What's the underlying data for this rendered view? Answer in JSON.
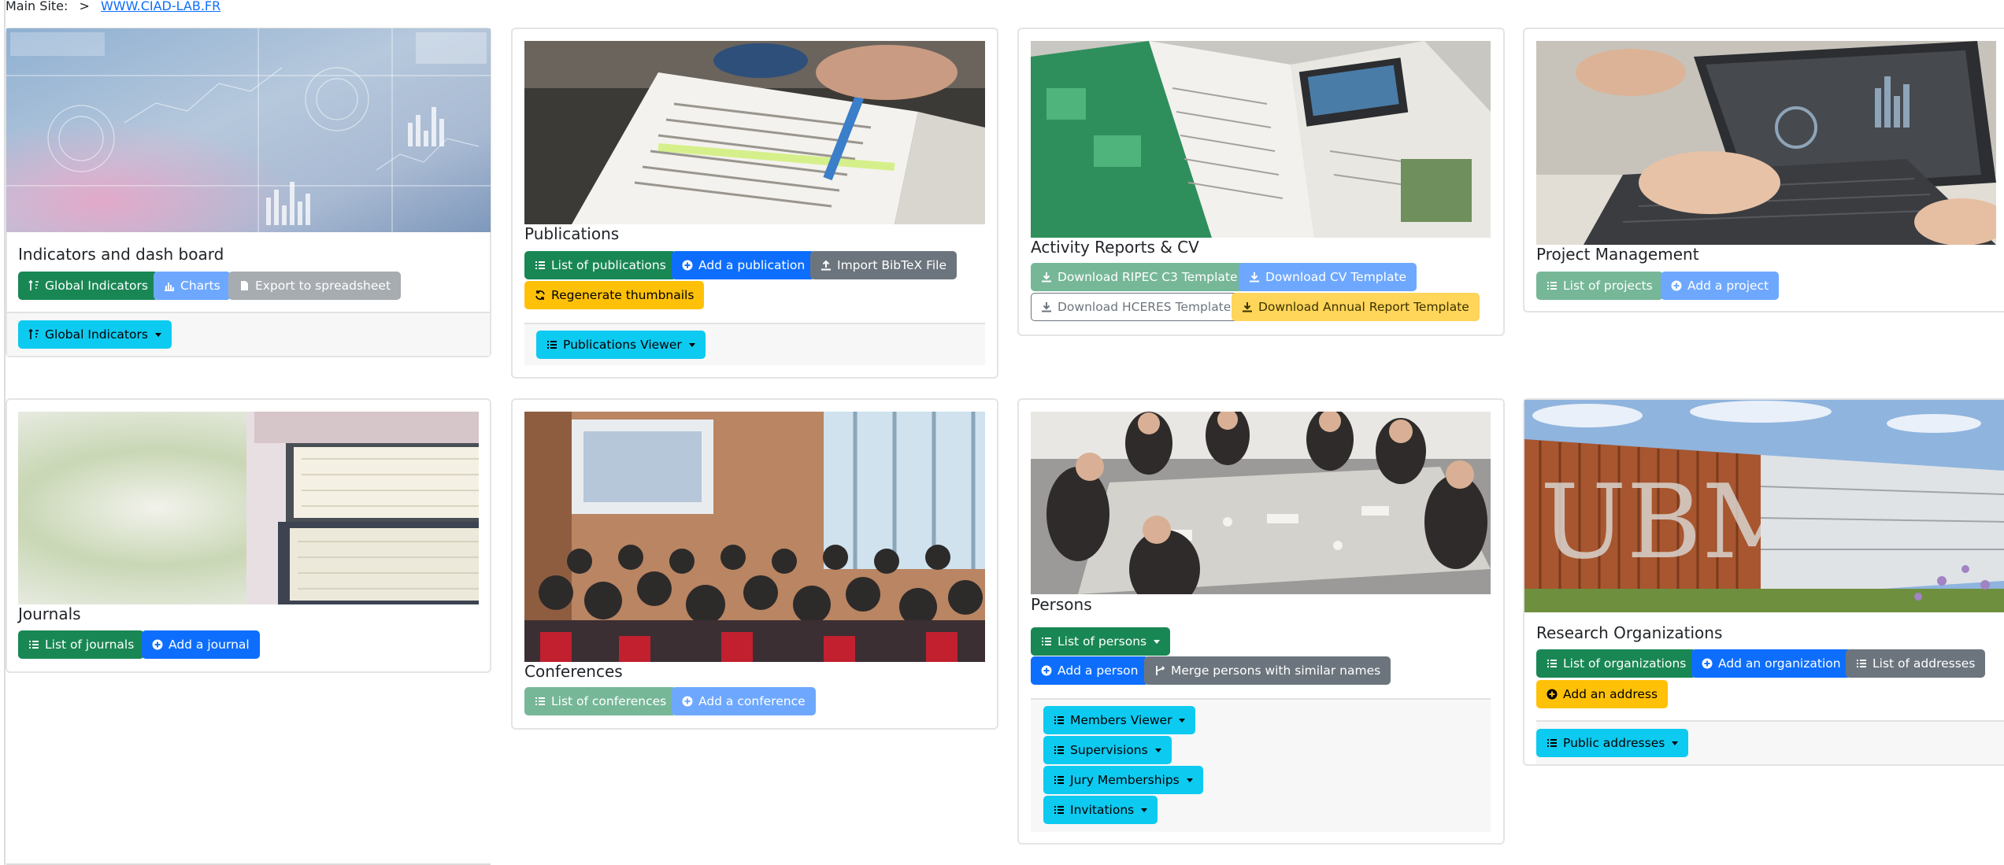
{
  "breadcrumb": {
    "label": "Main Site:",
    "sep": ">",
    "link": "WWW.CIAD-LAB.FR"
  },
  "colors": {
    "success": "#198754",
    "primary": "#0d6efd",
    "secondary": "#6c757d",
    "warning": "#ffc107",
    "info": "#0dcaf0",
    "link": "#0d6efd"
  },
  "cards": {
    "indicators": {
      "title": "Indicators and dash board",
      "image": "dashboard-illustration",
      "buttons": [
        "Global Indicators",
        "Charts",
        "Export to spreadsheet"
      ],
      "footer_dropdown": "Global Indicators"
    },
    "publications": {
      "title": "Publications",
      "image": "reading-document-photo",
      "buttons": [
        "List of publications",
        "Add a publication",
        "Import BibTeX File",
        "Regenerate thumbnails"
      ],
      "footer_dropdown": "Publications Viewer"
    },
    "activity": {
      "title": "Activity Reports & CV",
      "image": "reports-photo",
      "buttons": [
        "Download RIPEC C3 Template",
        "Download CV Template",
        "Download HCERES Template",
        "Download Annual Report Template"
      ]
    },
    "projects": {
      "title": "Project Management",
      "image": "laptop-photo",
      "buttons": [
        "List of projects",
        "Add a project"
      ]
    },
    "journals": {
      "title": "Journals",
      "image": "books-photo",
      "buttons": [
        "List of journals",
        "Add a journal"
      ]
    },
    "conferences": {
      "title": "Conferences",
      "image": "conference-audience-photo",
      "buttons": [
        "List of conferences",
        "Add a conference"
      ]
    },
    "persons": {
      "title": "Persons",
      "image": "meeting-photo",
      "buttons": [
        "List of persons",
        "Add a person",
        "Merge persons with similar names"
      ],
      "footer_dropdowns": [
        "Members Viewer",
        "Supervisions",
        "Jury Memberships",
        "Invitations"
      ]
    },
    "organizations": {
      "title": "Research Organizations",
      "image": "building-photo",
      "building_sign": "UBM",
      "buttons": [
        "List of organizations",
        "Add an organization",
        "List of addresses",
        "Add an address"
      ],
      "footer_dropdown": "Public addresses"
    }
  }
}
